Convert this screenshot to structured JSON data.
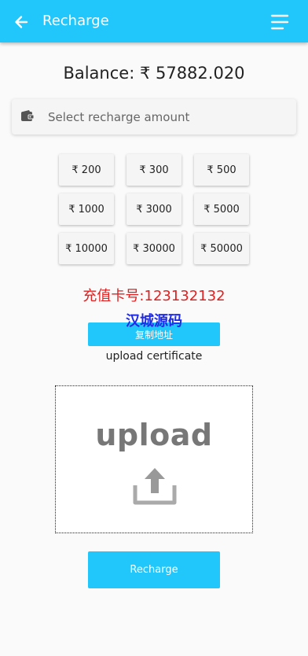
{
  "header": {
    "title": "Recharge",
    "back_icon": "arrow-left-icon",
    "menu_icon": "menu-icon",
    "bg_color": "#21c6fb"
  },
  "balance": {
    "text": "Balance: ₹ 57882.020"
  },
  "select": {
    "icon": "wallet-icon",
    "placeholder": "Select recharge amount"
  },
  "amounts": [
    "₹ 200",
    "₹ 300",
    "₹ 500",
    "₹ 1000",
    "₹ 3000",
    "₹ 5000",
    "₹ 10000",
    "₹ 30000",
    "₹ 50000"
  ],
  "card": {
    "text": "充值卡号:123132132",
    "color": "#e02020"
  },
  "watermark": {
    "text": "汉城源码",
    "color": "#1f2be6"
  },
  "copy_button": {
    "label": "复制地址"
  },
  "upload": {
    "caption": "upload certificate",
    "box_word": "upload",
    "icon": "upload-arrow-icon"
  },
  "recharge_button": {
    "label": "Recharge"
  }
}
